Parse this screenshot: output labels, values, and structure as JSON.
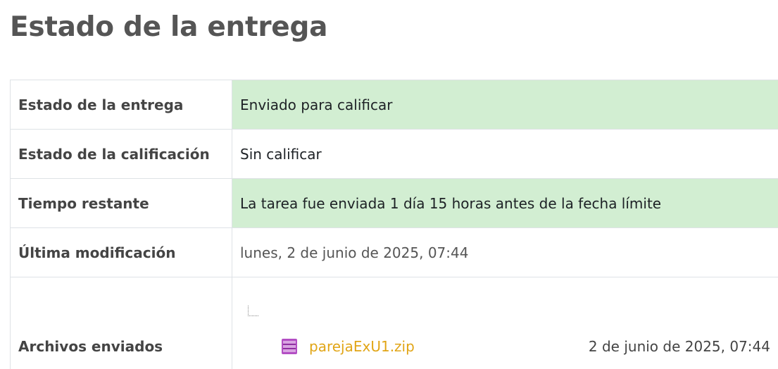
{
  "page": {
    "title": "Estado de la entrega"
  },
  "rows": [
    {
      "label": "Estado de la entrega",
      "value": "Enviado para calificar"
    },
    {
      "label": "Estado de la calificación",
      "value": "Sin calificar"
    },
    {
      "label": "Tiempo restante",
      "value": "La tarea fue enviada 1 día 15 horas antes de la fecha límite"
    },
    {
      "label": "Última modificación",
      "value": "lunes, 2 de junio de 2025, 07:44"
    }
  ],
  "files": {
    "label": "Archivos enviados",
    "items": [
      {
        "name": "parejaExU1.zip",
        "date": "2 de junio de 2025, 07:44",
        "icon": "archive-zip-icon"
      }
    ]
  },
  "colors": {
    "success_bg": "#d2eed2",
    "link": "#e1a516",
    "zip_icon": "#b34fc4"
  }
}
